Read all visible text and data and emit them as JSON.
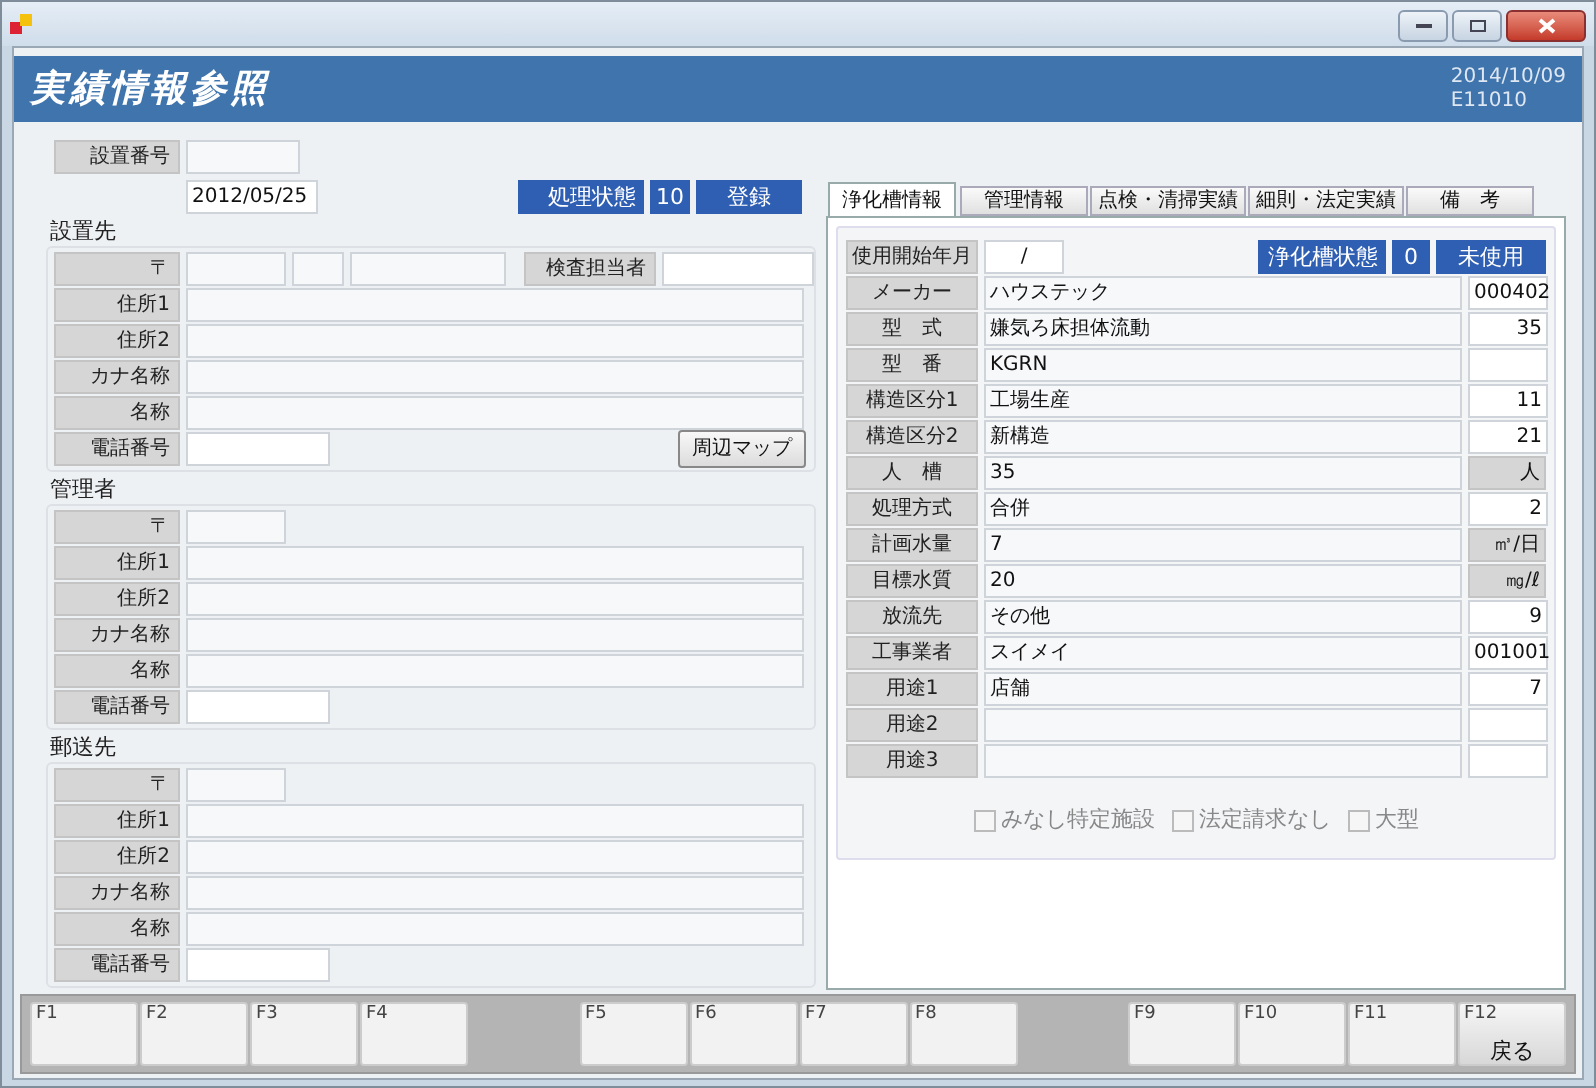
{
  "header": {
    "title": "実績情報参照",
    "date": "2014/10/09",
    "screen_code": "E11010"
  },
  "install": {
    "label": "設置番号",
    "date": "2012/05/25"
  },
  "status": {
    "label": "処理状態",
    "code": "10",
    "value": "登録"
  },
  "sections": [
    {
      "heading": "設置先",
      "rows": [
        {
          "label": "〒",
          "kind": "postal",
          "extra_label": "検査担当者"
        },
        {
          "label": "住所1",
          "kind": "wide"
        },
        {
          "label": "住所2",
          "kind": "wide"
        },
        {
          "label": "カナ名称",
          "kind": "wide"
        },
        {
          "label": "名称",
          "kind": "wide"
        },
        {
          "label": "電話番号",
          "kind": "phone",
          "button": "周辺マップ"
        }
      ]
    },
    {
      "heading": "管理者",
      "rows": [
        {
          "label": "〒",
          "kind": "postal"
        },
        {
          "label": "住所1",
          "kind": "wide"
        },
        {
          "label": "住所2",
          "kind": "wide"
        },
        {
          "label": "カナ名称",
          "kind": "wide"
        },
        {
          "label": "名称",
          "kind": "wide"
        },
        {
          "label": "電話番号",
          "kind": "phone"
        }
      ]
    },
    {
      "heading": "郵送先",
      "rows": [
        {
          "label": "〒",
          "kind": "postal"
        },
        {
          "label": "住所1",
          "kind": "wide"
        },
        {
          "label": "住所2",
          "kind": "wide"
        },
        {
          "label": "カナ名称",
          "kind": "wide"
        },
        {
          "label": "名称",
          "kind": "wide"
        },
        {
          "label": "電話番号",
          "kind": "phone"
        }
      ]
    }
  ],
  "tabs": [
    {
      "label": "浄化槽情報",
      "selected": true
    },
    {
      "label": "管理情報",
      "selected": false
    },
    {
      "label": "点検・清掃実績",
      "selected": false
    },
    {
      "label": "細則・法定実績",
      "selected": false
    },
    {
      "label": "備　考",
      "selected": false
    }
  ],
  "start": {
    "label": "使用開始年月",
    "value": "/"
  },
  "tank_status": {
    "label": "浄化槽状態",
    "code": "0",
    "value": "未使用"
  },
  "rows": [
    {
      "label": "メーカー",
      "value": "ハウステック",
      "code": "000402",
      "kind": "code"
    },
    {
      "label": "型　式",
      "value": "嫌気ろ床担体流動",
      "code": "35",
      "kind": "code"
    },
    {
      "label": "型　番",
      "value": "KGRN",
      "kind": "code"
    },
    {
      "label": "構造区分1",
      "value": "工場生産",
      "code": "11",
      "kind": "code"
    },
    {
      "label": "構造区分2",
      "value": "新構造",
      "code": "21",
      "kind": "code"
    },
    {
      "label": "人　槽",
      "value": "35",
      "code": "人",
      "kind": "unit"
    },
    {
      "label": "処理方式",
      "value": "合併",
      "code": "2",
      "kind": "code"
    },
    {
      "label": "計画水量",
      "value": "7",
      "code": "㎥/日",
      "kind": "unit"
    },
    {
      "label": "目標水質",
      "value": "20",
      "code": "㎎/ℓ",
      "kind": "unit"
    },
    {
      "label": "放流先",
      "value": "その他",
      "code": "9",
      "kind": "code"
    },
    {
      "label": "工事業者",
      "value": "スイメイ",
      "code": "001001",
      "kind": "code"
    },
    {
      "label": "用途1",
      "value": "店舗",
      "code": "7",
      "kind": "code"
    },
    {
      "label": "用途2",
      "kind": "code"
    },
    {
      "label": "用途3",
      "kind": "code"
    }
  ],
  "checkboxes": [
    {
      "label": "みなし特定施設",
      "checked": false
    },
    {
      "label": "法定請求なし",
      "checked": false
    },
    {
      "label": "大型",
      "checked": false
    }
  ],
  "fkey_groups": [
    [
      {
        "key": "F1"
      },
      {
        "key": "F2"
      },
      {
        "key": "F3"
      },
      {
        "key": "F4"
      }
    ],
    [
      {
        "key": "F5"
      },
      {
        "key": "F6"
      },
      {
        "key": "F7"
      },
      {
        "key": "F8"
      }
    ],
    [
      {
        "key": "F9"
      },
      {
        "key": "F10"
      },
      {
        "key": "F11"
      },
      {
        "key": "F12",
        "label": "戻る"
      }
    ]
  ]
}
